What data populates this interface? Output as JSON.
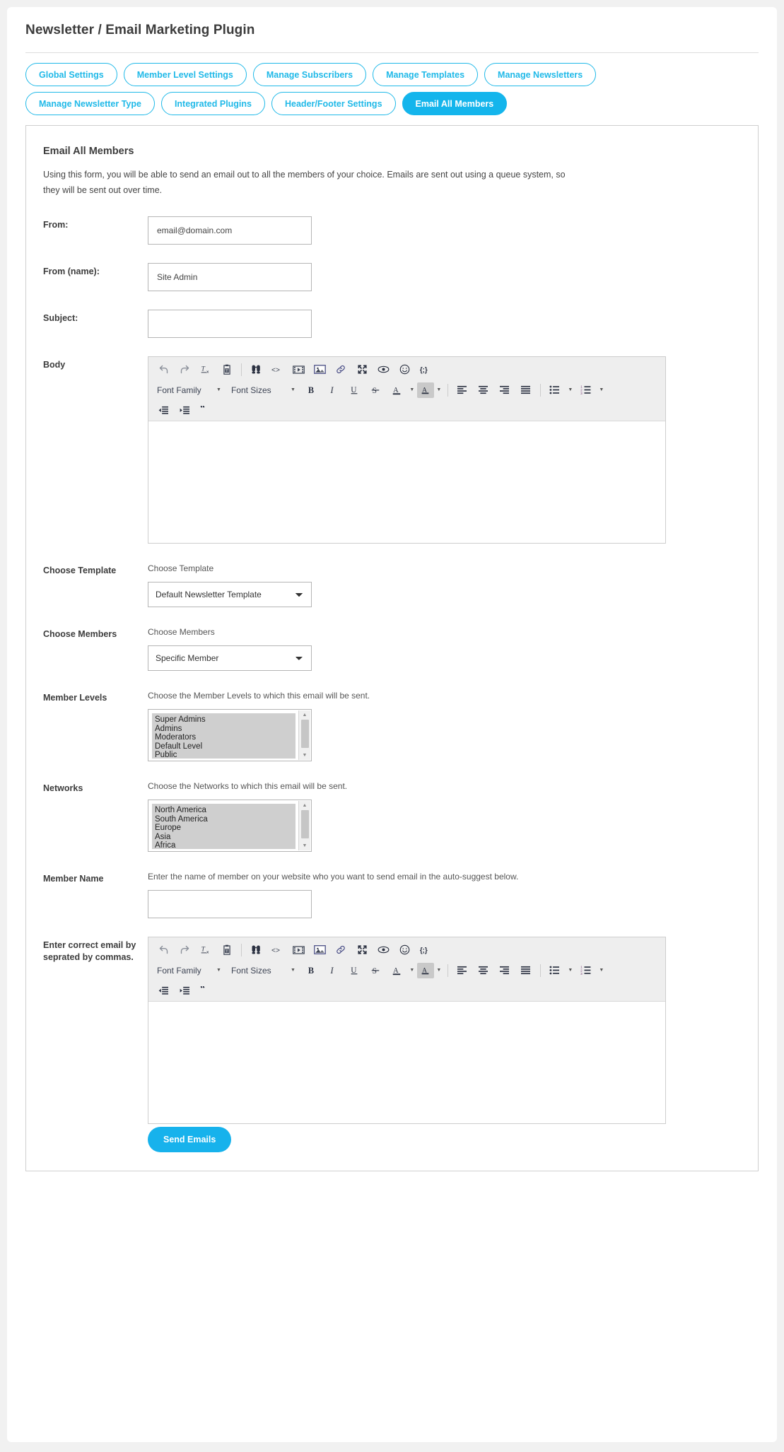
{
  "page": {
    "title": "Newsletter / Email Marketing Plugin"
  },
  "tabs": {
    "row1": [
      {
        "label": "Global Settings",
        "active": false
      },
      {
        "label": "Member Level Settings",
        "active": false
      },
      {
        "label": "Manage Subscribers",
        "active": false
      },
      {
        "label": "Manage Templates",
        "active": false
      },
      {
        "label": "Manage Newsletters",
        "active": false
      }
    ],
    "row2": [
      {
        "label": "Manage Newsletter Type",
        "active": false
      },
      {
        "label": "Integrated Plugins",
        "active": false
      },
      {
        "label": "Header/Footer Settings",
        "active": false
      },
      {
        "label": "Email All Members",
        "active": true
      }
    ]
  },
  "panel": {
    "title": "Email All Members",
    "description": "Using this form, you will be able to send an email out to all the members of your choice. Emails are sent out using a queue system, so they will be sent out over time."
  },
  "form": {
    "from": {
      "label": "From:",
      "value": "email@domain.com"
    },
    "from_name": {
      "label": "From (name):",
      "value": "Site Admin"
    },
    "subject": {
      "label": "Subject:",
      "value": ""
    },
    "body": {
      "label": "Body"
    },
    "choose_template": {
      "label": "Choose Template",
      "hint": "Choose Template",
      "selected": "Default Newsletter Template",
      "options": [
        "Default Newsletter Template"
      ]
    },
    "choose_members": {
      "label": "Choose Members",
      "hint": "Choose Members",
      "selected": "Specific Member",
      "options": [
        "Specific Member"
      ]
    },
    "member_levels": {
      "label": "Member Levels",
      "hint": "Choose the Member Levels to which this email will be sent.",
      "options": [
        "Super Admins",
        "Admins",
        "Moderators",
        "Default Level",
        "Public"
      ]
    },
    "networks": {
      "label": "Networks",
      "hint": "Choose the Networks to which this email will be sent.",
      "options": [
        "North America",
        "South America",
        "Europe",
        "Asia",
        "Africa"
      ]
    },
    "member_name": {
      "label": "Member Name",
      "hint": "Enter the name of member on your website who you want to send email in the auto-suggest below.",
      "value": ""
    },
    "emails": {
      "label": "Enter correct email by seprated by commas."
    },
    "submit": {
      "label": "Send Emails"
    }
  },
  "editor_toolbar": {
    "row1_icons": [
      "undo-icon",
      "redo-icon",
      "remove-format-icon",
      "paste-text-icon",
      "find-replace-icon",
      "source-code-icon",
      "media-icon",
      "image-icon",
      "link-icon",
      "fullscreen-icon",
      "preview-icon",
      "emoticon-icon",
      "template-icon"
    ],
    "font_family_label": "Font Family",
    "font_sizes_label": "Font Sizes",
    "row2_icons": [
      "bold-icon",
      "italic-icon",
      "underline-icon",
      "strikethrough-icon",
      "text-color-icon",
      "background-color-icon",
      "align-left-icon",
      "align-center-icon",
      "align-right-icon",
      "align-justify-icon",
      "bullet-list-icon",
      "numbered-list-icon"
    ],
    "row3_icons": [
      "outdent-icon",
      "indent-icon",
      "blockquote-icon"
    ]
  },
  "colors": {
    "accent": "#14b5ec",
    "tab_border": "#20b9e8",
    "page_bg": "#f1f1f1",
    "panel_border": "#cfcfcf"
  }
}
